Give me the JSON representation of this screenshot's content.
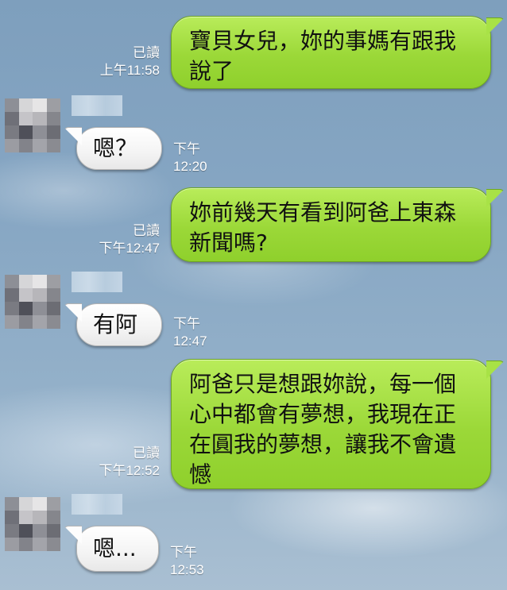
{
  "conversation": {
    "contact": {
      "avatar_icon": "pixelated-avatar-icon"
    },
    "messages": [
      {
        "direction": "outgoing",
        "text_lines": [
          "寶貝女兒，妳的事媽有跟我",
          "說了"
        ],
        "read_label": "已讀",
        "time": "上午11:58"
      },
      {
        "direction": "incoming",
        "text_lines": [
          "嗯？"
        ],
        "time": "下午12:20"
      },
      {
        "direction": "outgoing",
        "text_lines": [
          "妳前幾天有看到阿爸上東森",
          "新聞嗎?"
        ],
        "read_label": "已讀",
        "time": "下午12:47"
      },
      {
        "direction": "incoming",
        "text_lines": [
          "有阿"
        ],
        "time": "下午12:47"
      },
      {
        "direction": "outgoing",
        "text_lines": [
          "阿爸只是想跟妳說，每一個",
          "心中都會有夢想，我現在正",
          "在圓我的夢想，讓我不會遺",
          "憾"
        ],
        "read_label": "已讀",
        "time": "下午12:52"
      },
      {
        "direction": "incoming",
        "text_lines": [
          "嗯..."
        ],
        "time": "下午12:53"
      }
    ]
  },
  "colors": {
    "outgoing_bubble": "#9bd838",
    "incoming_bubble": "#ffffff",
    "background_sky": "#86a6c3"
  }
}
